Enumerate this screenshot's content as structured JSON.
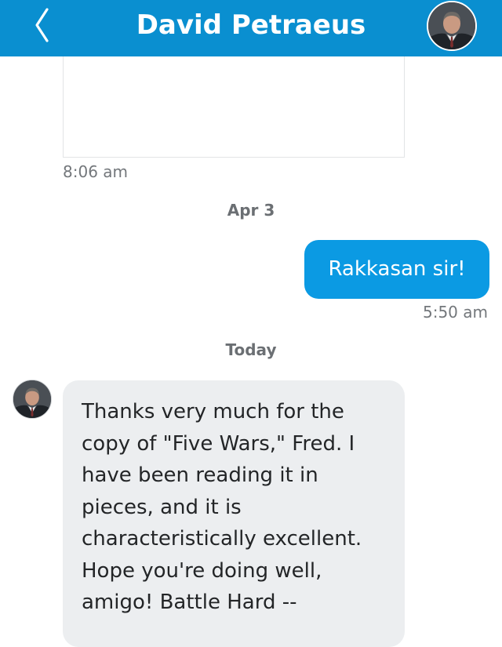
{
  "header": {
    "title": "David Petraeus",
    "back_icon": "chevron-left-icon",
    "avatar_icon": "profile-photo"
  },
  "colors": {
    "header_bg": "#0a8fd0",
    "outgoing_bubble": "#0b9ae3",
    "incoming_bubble": "#eceef0",
    "timestamp_text": "#73777b"
  },
  "conversation": {
    "attachment_time": "8:06 am",
    "date_separator_1": "Apr 3",
    "outgoing_message": {
      "text": "Rakkasan sir!",
      "time": "5:50 am"
    },
    "date_separator_2": "Today",
    "incoming_message": {
      "text": "Thanks very much for the\ncopy of \"Five Wars,\" Fred.  I\nhave been reading it in\npieces, and it is\ncharacteristically excellent.\nHope you're doing well,\namigo!  Battle Hard --"
    }
  }
}
